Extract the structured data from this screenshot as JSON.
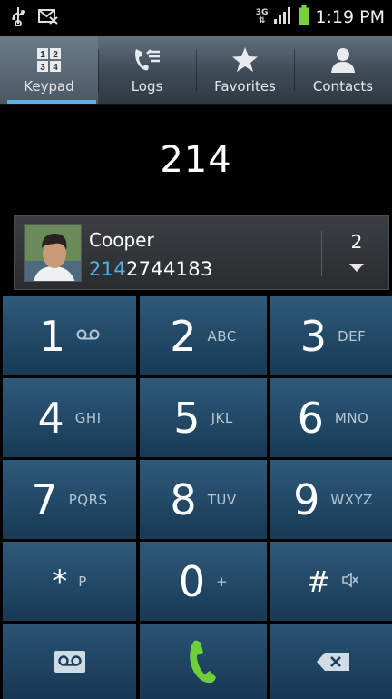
{
  "status_bar": {
    "network_label": "3G",
    "time": "1:19 PM",
    "icons": [
      "usb-icon",
      "missed-call-icon",
      "network-3g-icon",
      "signal-icon",
      "battery-icon"
    ]
  },
  "tabs": [
    {
      "label": "Keypad",
      "icon": "keypad-icon",
      "active": true
    },
    {
      "label": "Logs",
      "icon": "logs-icon",
      "active": false
    },
    {
      "label": "Favorites",
      "icon": "star-icon",
      "active": false
    },
    {
      "label": "Contacts",
      "icon": "person-icon",
      "active": false
    }
  ],
  "display": {
    "digits": "214"
  },
  "suggestion": {
    "name": "Cooper",
    "number_match": "214",
    "number_rest": "2744183",
    "count": "2"
  },
  "keypad": {
    "keys": [
      {
        "digit": "1",
        "letters": ""
      },
      {
        "digit": "2",
        "letters": "ABC"
      },
      {
        "digit": "3",
        "letters": "DEF"
      },
      {
        "digit": "4",
        "letters": "GHI"
      },
      {
        "digit": "5",
        "letters": "JKL"
      },
      {
        "digit": "6",
        "letters": "MNO"
      },
      {
        "digit": "7",
        "letters": "PQRS"
      },
      {
        "digit": "8",
        "letters": "TUV"
      },
      {
        "digit": "9",
        "letters": "WXYZ"
      },
      {
        "digit": "*",
        "letters": "P"
      },
      {
        "digit": "0",
        "letters": "+"
      },
      {
        "digit": "#",
        "letters": ""
      }
    ]
  },
  "colors": {
    "accent": "#5ab4e6",
    "key_top": "#2e5a7a",
    "key_bottom": "#173a55",
    "call_green": "#6fcf3a"
  }
}
